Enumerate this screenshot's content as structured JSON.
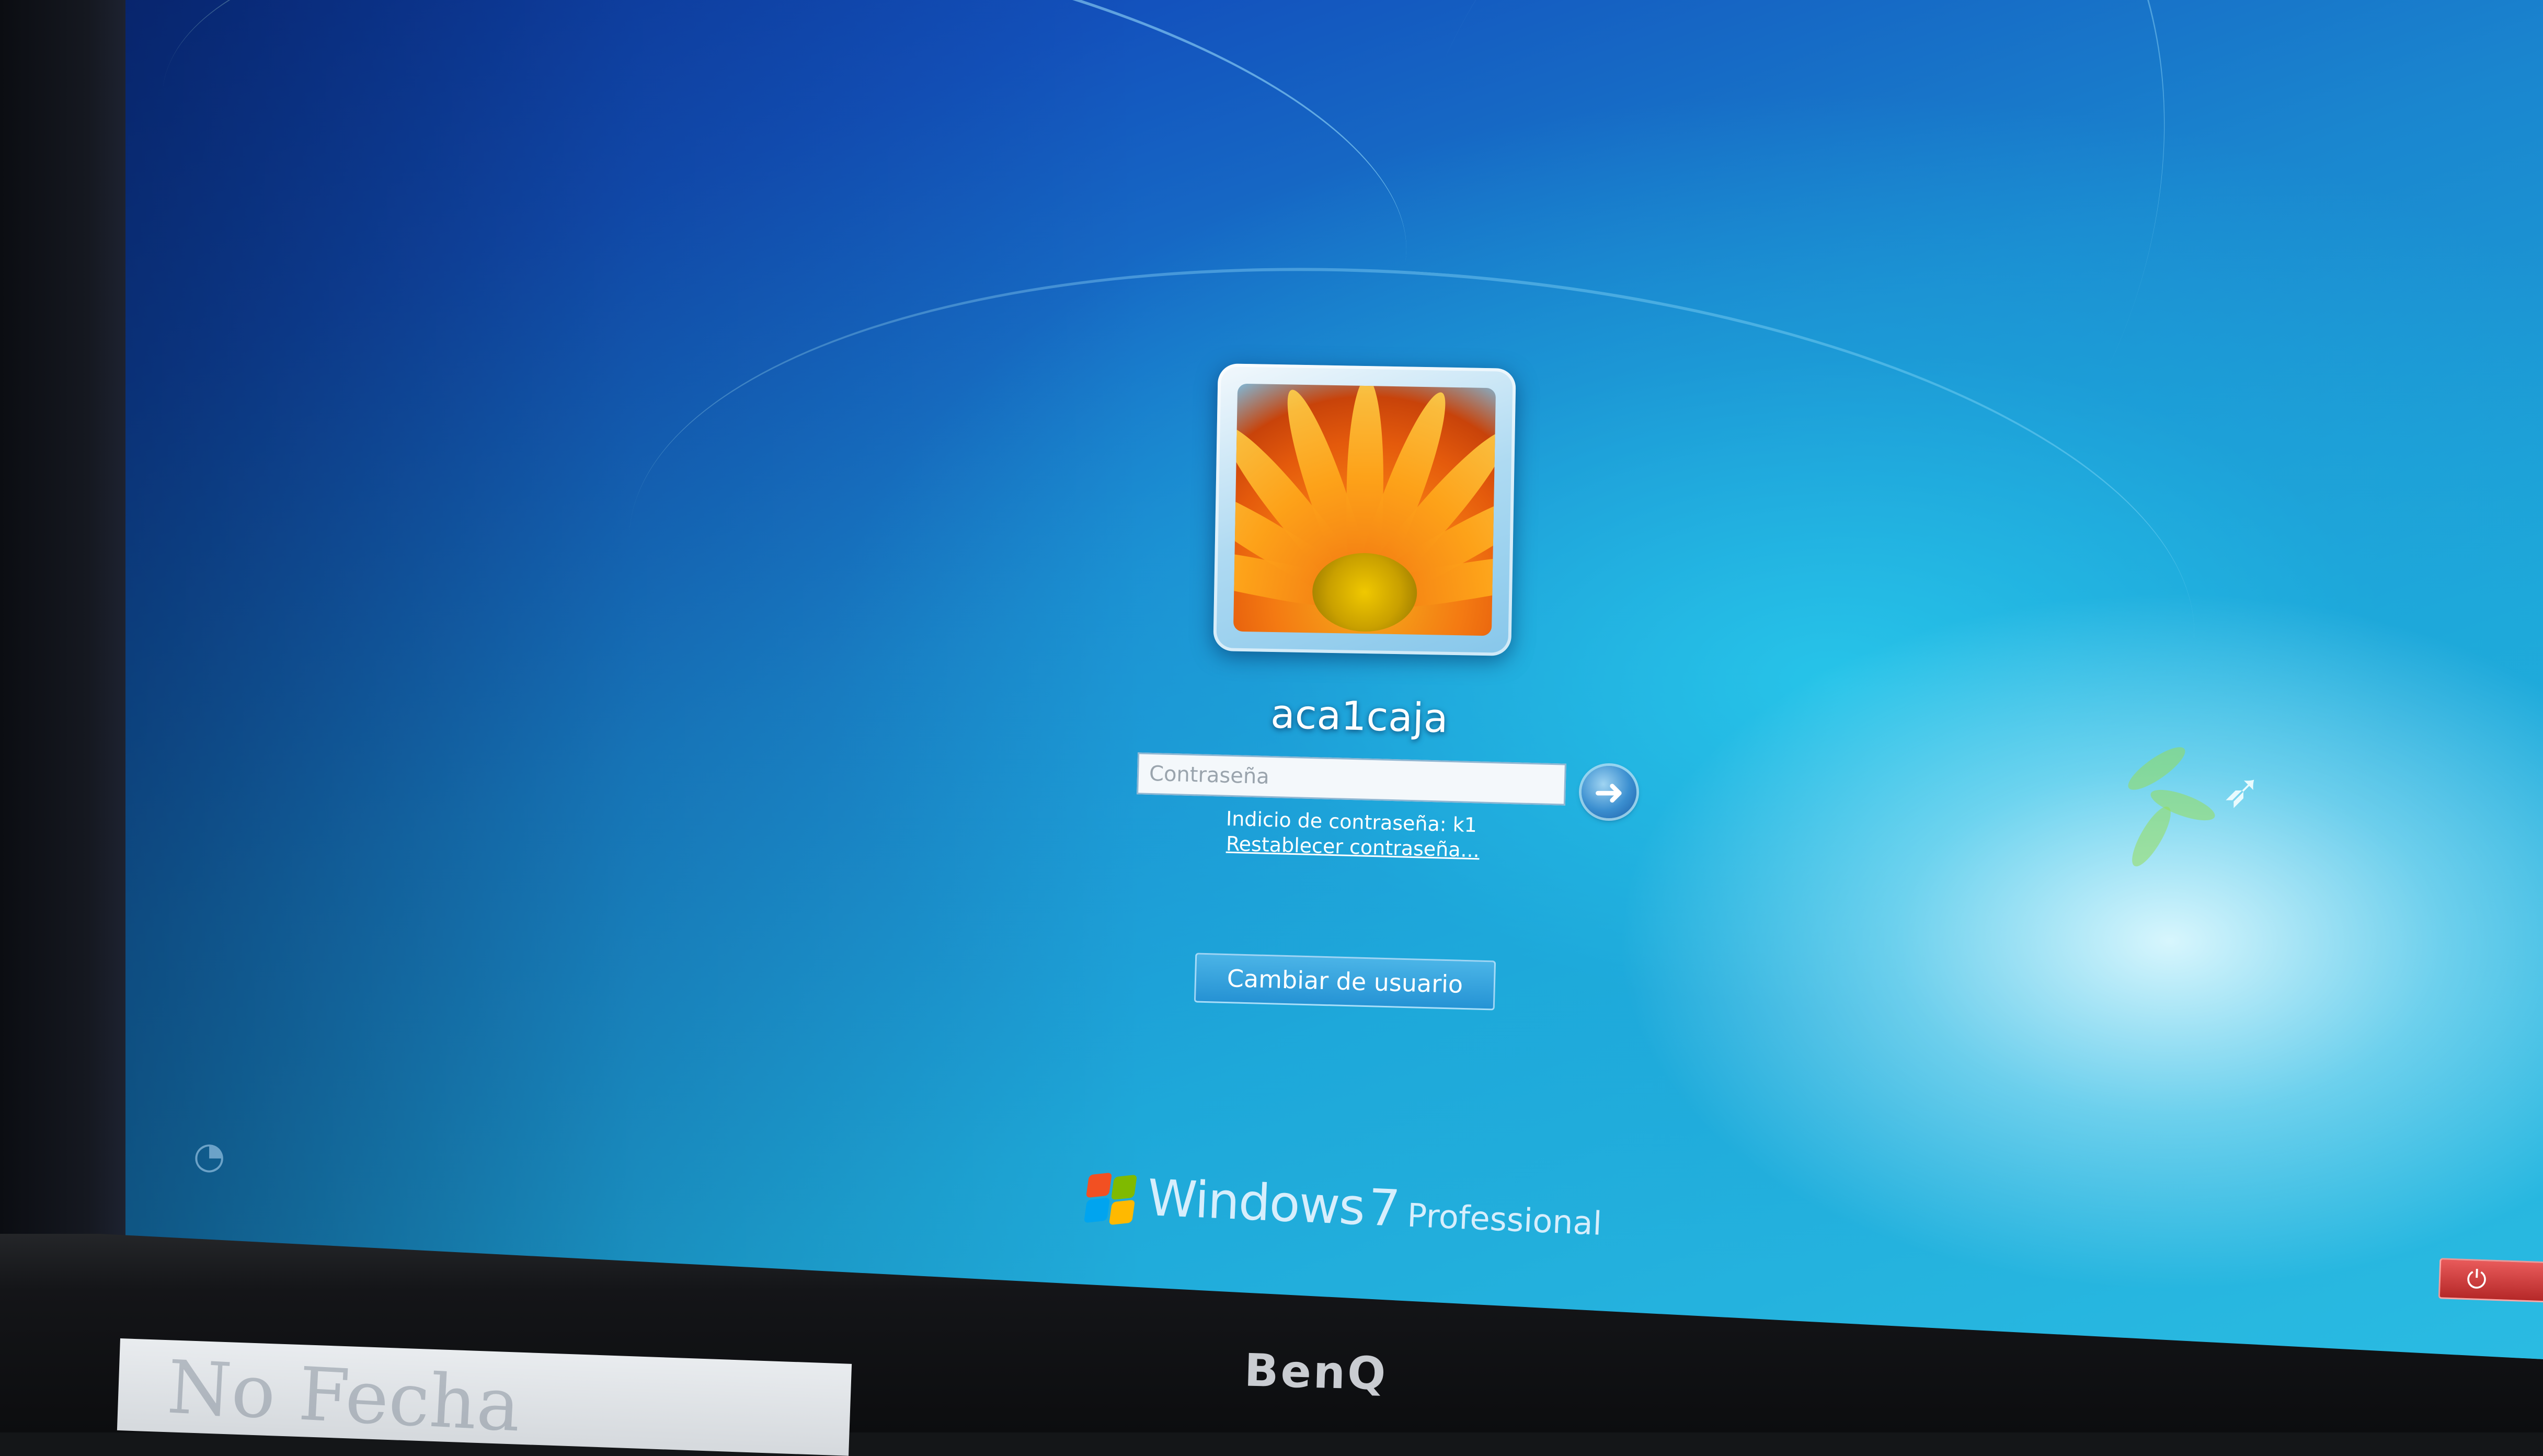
{
  "login": {
    "username": "aca1caja",
    "password_placeholder": "Contraseña",
    "password_hint": "Indicio de contraseña: k1",
    "reset_password_link": "Restablecer contraseña...",
    "switch_user_button": "Cambiar de usuario"
  },
  "branding": {
    "wordmark": "Windows",
    "version": "7",
    "edition": "Professional"
  },
  "monitor": {
    "brand": "BenQ"
  },
  "desk": {
    "note_text": "No Fecha"
  },
  "icons": {
    "submit": "arrow-right-icon",
    "ease_of_access": "ease-of-access-icon",
    "shutdown": "power-icon"
  },
  "colors": {
    "background_top": "#0d3aa8",
    "background_bottom": "#2bbde3",
    "shutdown_red": "#b52828",
    "text": "#ffffff"
  }
}
